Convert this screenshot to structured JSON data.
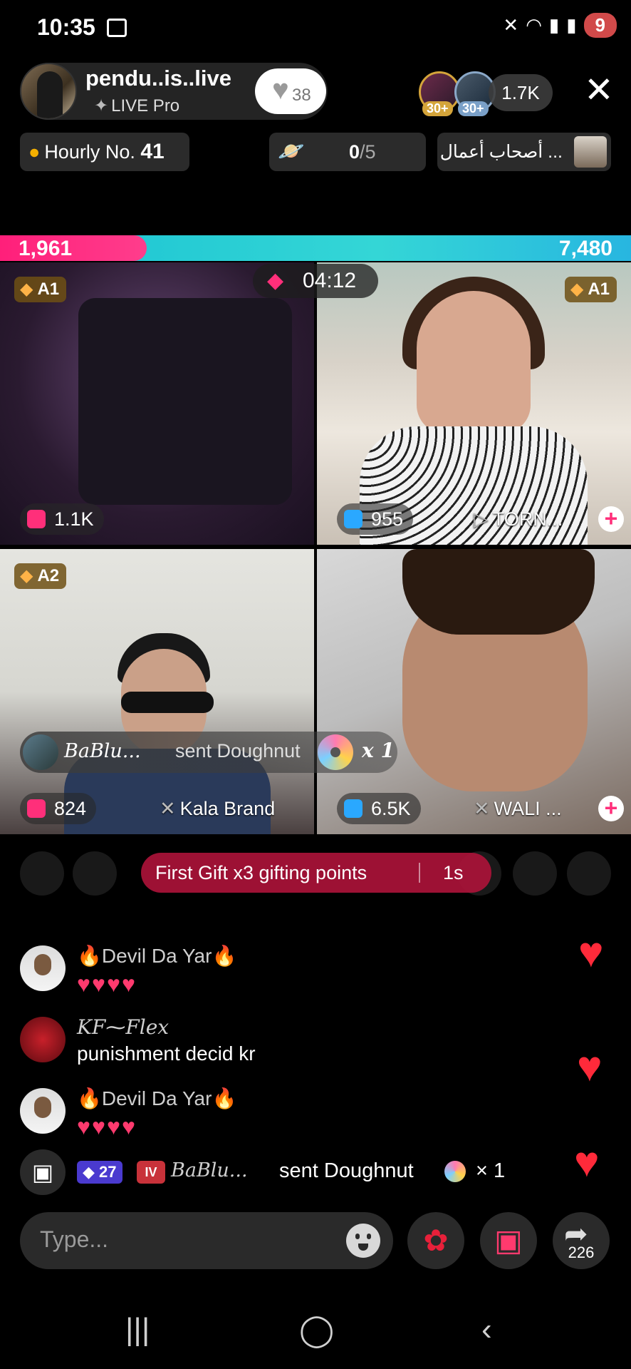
{
  "status_bar": {
    "time": "10:35",
    "battery": "9",
    "icons": [
      "screenshot-icon",
      "mute-icon",
      "wifi-icon",
      "signal-icon",
      "signal-icon"
    ]
  },
  "host": {
    "name": "pendu..is..live",
    "badge": "LIVE Pro",
    "like_count": "38"
  },
  "viewers": {
    "v1_level": "30+",
    "v2_level": "30+",
    "count": "1.7K"
  },
  "chips": {
    "hourly_label": "Hourly No.",
    "hourly_value": "41",
    "planet_value": "0",
    "planet_total": "/5",
    "arabic_label": "... أصحاب أعمال"
  },
  "battle": {
    "left_score": "1,961",
    "right_score": "7,480",
    "timer": "04:12"
  },
  "tiles": [
    {
      "badge": "A1",
      "score": "1.1K",
      "tag": ""
    },
    {
      "badge": "A1",
      "score": "955",
      "tag": "TORN..."
    },
    {
      "badge": "A2",
      "score": "824",
      "tag": "Kala Brand"
    },
    {
      "badge": "",
      "score": "6.5K",
      "tag": "WALI ..."
    }
  ],
  "gift_popup": {
    "sender": "BaBlu...",
    "action": "sent Doughnut",
    "count": "x 1"
  },
  "first_gift": {
    "text": "First Gift x3 gifting points",
    "seconds": "1s"
  },
  "chat": [
    {
      "name": "Devil Da Yar",
      "text": "♥♥♥♥"
    },
    {
      "name": "KF⁓Flex",
      "text": "punishment decid kr"
    },
    {
      "name": "Devil Da Yar",
      "text": "♥♥♥♥"
    }
  ],
  "gift_line": {
    "level": "27",
    "tier": "IV",
    "sender": "BaBlu...",
    "text": "sent Doughnut",
    "count": "× 1"
  },
  "input": {
    "placeholder": "Type..."
  },
  "share_count": "226",
  "colors": {
    "accent_pink": "#ff2f7a",
    "battle_cyan": "#34d6d6",
    "gift_banner": "#aa1238"
  }
}
